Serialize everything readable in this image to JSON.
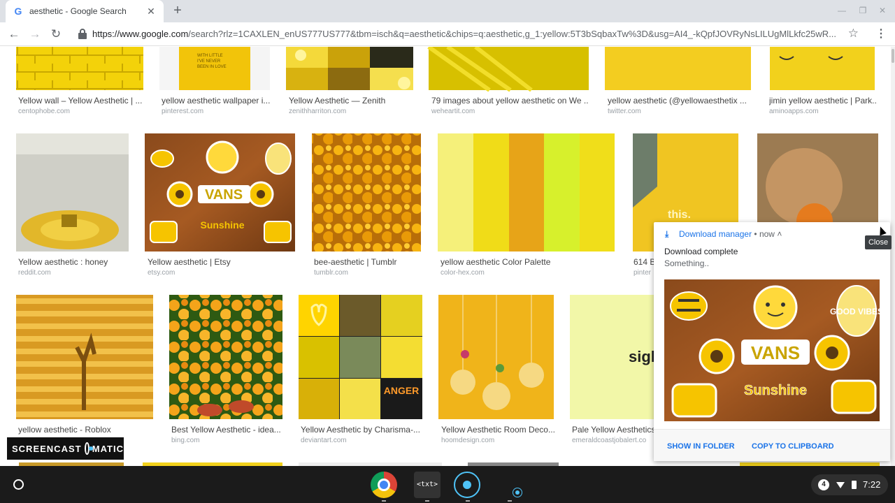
{
  "browser": {
    "tab_title": "aesthetic - Google Search",
    "tab_icon": "G",
    "tab_close": "✕",
    "new_tab": "+",
    "url_host": "https://www.google.com",
    "url_path": "/search?rlz=1CAXLEN_enUS777US777&tbm=isch&q=aesthetic&chips=q:aesthetic,g_1:yellow:5T3bSqbaxTw%3D&usg=AI4_-kQpfJOVRyNsLILUgMlLkfc25wR..."
  },
  "results": {
    "row1": [
      {
        "title": "Yellow wall – Yellow Aesthetic | ...",
        "source": "centophobe.com"
      },
      {
        "title": "yellow aesthetic wallpaper i...",
        "source": "pinterest.com"
      },
      {
        "title": "Yellow Aesthetic — Zenith",
        "source": "zenithharriton.com"
      },
      {
        "title": "79 images about yellow aesthetic on We ...",
        "source": "weheartit.com"
      },
      {
        "title": "yellow aesthetic (@yellowaesthetix ...",
        "source": "twitter.com"
      },
      {
        "title": "jimin yellow aesthetic | Park...",
        "source": "aminoapps.com"
      }
    ],
    "row2": [
      {
        "title": "Yellow aesthetic : honey",
        "source": "reddit.com"
      },
      {
        "title": "Yellow aesthetic | Etsy",
        "source": "etsy.com"
      },
      {
        "title": "bee-aesthetic | Tumblr",
        "source": "tumblr.com"
      },
      {
        "title": "yellow aesthetic Color Palette",
        "source": "color-hex.com"
      },
      {
        "title": "614 B",
        "source": "pinter"
      }
    ],
    "row3": [
      {
        "title": "yellow aesthetic - Roblox",
        "source": ""
      },
      {
        "title": "Best Yellow Aesthetic - idea...",
        "source": "bing.com"
      },
      {
        "title": "Yellow Aesthetic by Charisma-...",
        "source": "deviantart.com"
      },
      {
        "title": "Yellow Aesthetic Room Deco...",
        "source": "hoomdesign.com"
      },
      {
        "title": "Pale Yellow Aesthetics",
        "source": "emeraldcoastjobalert.co"
      }
    ],
    "image_text": {
      "pale_yellow": "sigh",
      "collage_sign": "ANGER",
      "poster": "this.",
      "sticker_brand": "VANS",
      "sticker_word": "Sunshine",
      "sticker_vibes": "GOOD VIBES"
    }
  },
  "palette": [
    "#f5f07a",
    "#f0dc18",
    "#e7a418",
    "#d7f02c",
    "#f0de1a"
  ],
  "watermark": {
    "left": "SCREENCAST",
    "right": "MATIC"
  },
  "notification": {
    "app": "Download manager",
    "separator": "•",
    "time": "now",
    "title": "Download complete",
    "message": "Something..",
    "btn_folder": "SHOW IN FOLDER",
    "btn_clipboard": "COPY TO CLIPBOARD",
    "close_tooltip": "Close"
  },
  "shelf": {
    "txt_label": "<txt>",
    "notification_count": "4",
    "time": "7:22"
  },
  "colors": {
    "accent_blue": "#1a73e8",
    "yellow": "#f4c20d",
    "shelf": "#1b1b1b"
  }
}
